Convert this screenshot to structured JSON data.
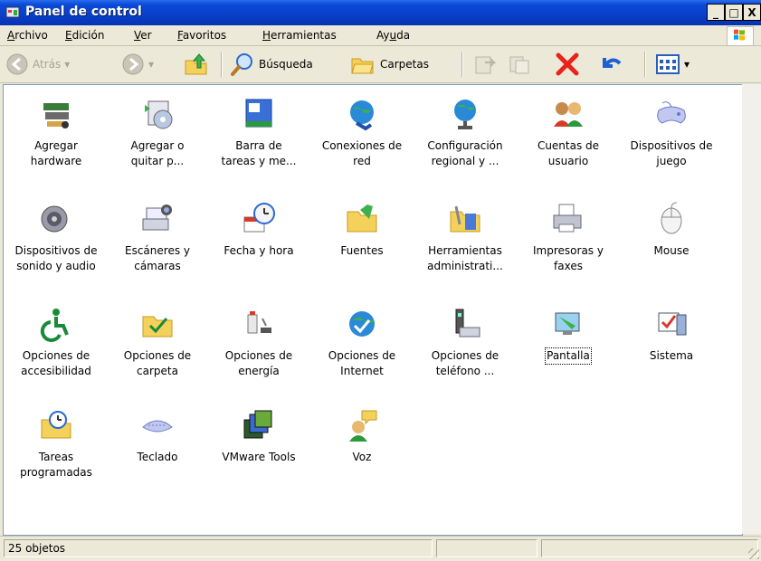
{
  "window": {
    "title": "Panel de control",
    "controls": [
      "_",
      "□",
      "X"
    ]
  },
  "menu": [
    {
      "label": "Archivo",
      "ul": "A",
      "rest": "rchivo"
    },
    {
      "label": "Edición",
      "ul": "E",
      "rest": "dición"
    },
    {
      "label": "Ver",
      "ul": "V",
      "rest": "er"
    },
    {
      "label": "Favoritos",
      "ul": "F",
      "rest": "avoritos"
    },
    {
      "label": "Herramientas",
      "ul": "H",
      "rest": "erramientas"
    },
    {
      "label": "Ayuda",
      "pre": "Ay",
      "ul": "u",
      "rest": "da"
    }
  ],
  "toolbar": {
    "back": "Atrás",
    "search": "Búsqueda",
    "folders": "Carpetas"
  },
  "items": [
    {
      "l1": "Agregar",
      "l2": "hardware",
      "icon": "add-hardware-icon"
    },
    {
      "l1": "Agregar o",
      "l2": "quitar p...",
      "icon": "add-remove-programs-icon"
    },
    {
      "l1": "Barra de",
      "l2": "tareas y me...",
      "icon": "taskbar-icon"
    },
    {
      "l1": "Conexiones de",
      "l2": "red",
      "icon": "network-connections-icon"
    },
    {
      "l1": "Configuración",
      "l2": "regional y ...",
      "icon": "regional-settings-icon"
    },
    {
      "l1": "Cuentas de",
      "l2": "usuario",
      "icon": "user-accounts-icon"
    },
    {
      "l1": "Dispositivos de",
      "l2": "juego",
      "icon": "game-controllers-icon"
    },
    {
      "l1": "Dispositivos de",
      "l2": "sonido y audio",
      "icon": "sound-devices-icon"
    },
    {
      "l1": "Escáneres y",
      "l2": "cámaras",
      "icon": "scanners-cameras-icon"
    },
    {
      "l1": "Fecha y hora",
      "l2": "",
      "icon": "date-time-icon"
    },
    {
      "l1": "Fuentes",
      "l2": "",
      "icon": "fonts-folder-icon"
    },
    {
      "l1": "Herramientas",
      "l2": "administrati...",
      "icon": "admin-tools-icon"
    },
    {
      "l1": "Impresoras y",
      "l2": "faxes",
      "icon": "printers-faxes-icon"
    },
    {
      "l1": "Mouse",
      "l2": "",
      "icon": "mouse-icon"
    },
    {
      "l1": "Opciones de",
      "l2": "accesibilidad",
      "icon": "accessibility-icon"
    },
    {
      "l1": "Opciones de",
      "l2": "carpeta",
      "icon": "folder-options-icon"
    },
    {
      "l1": "Opciones de",
      "l2": "energía",
      "icon": "power-options-icon"
    },
    {
      "l1": "Opciones de",
      "l2": "Internet",
      "icon": "internet-options-icon"
    },
    {
      "l1": "Opciones de",
      "l2": "teléfono ...",
      "icon": "phone-modem-icon"
    },
    {
      "l1": "Pantalla",
      "l2": "",
      "icon": "display-icon",
      "focused": true
    },
    {
      "l1": "Sistema",
      "l2": "",
      "icon": "system-icon"
    },
    {
      "l1": "Tareas",
      "l2": "programadas",
      "icon": "scheduled-tasks-icon"
    },
    {
      "l1": "Teclado",
      "l2": "",
      "icon": "keyboard-icon"
    },
    {
      "l1": "VMware Tools",
      "l2": "",
      "icon": "vmware-tools-icon"
    },
    {
      "l1": "Voz",
      "l2": "",
      "icon": "speech-icon"
    }
  ],
  "status": {
    "count": "25 objetos"
  }
}
